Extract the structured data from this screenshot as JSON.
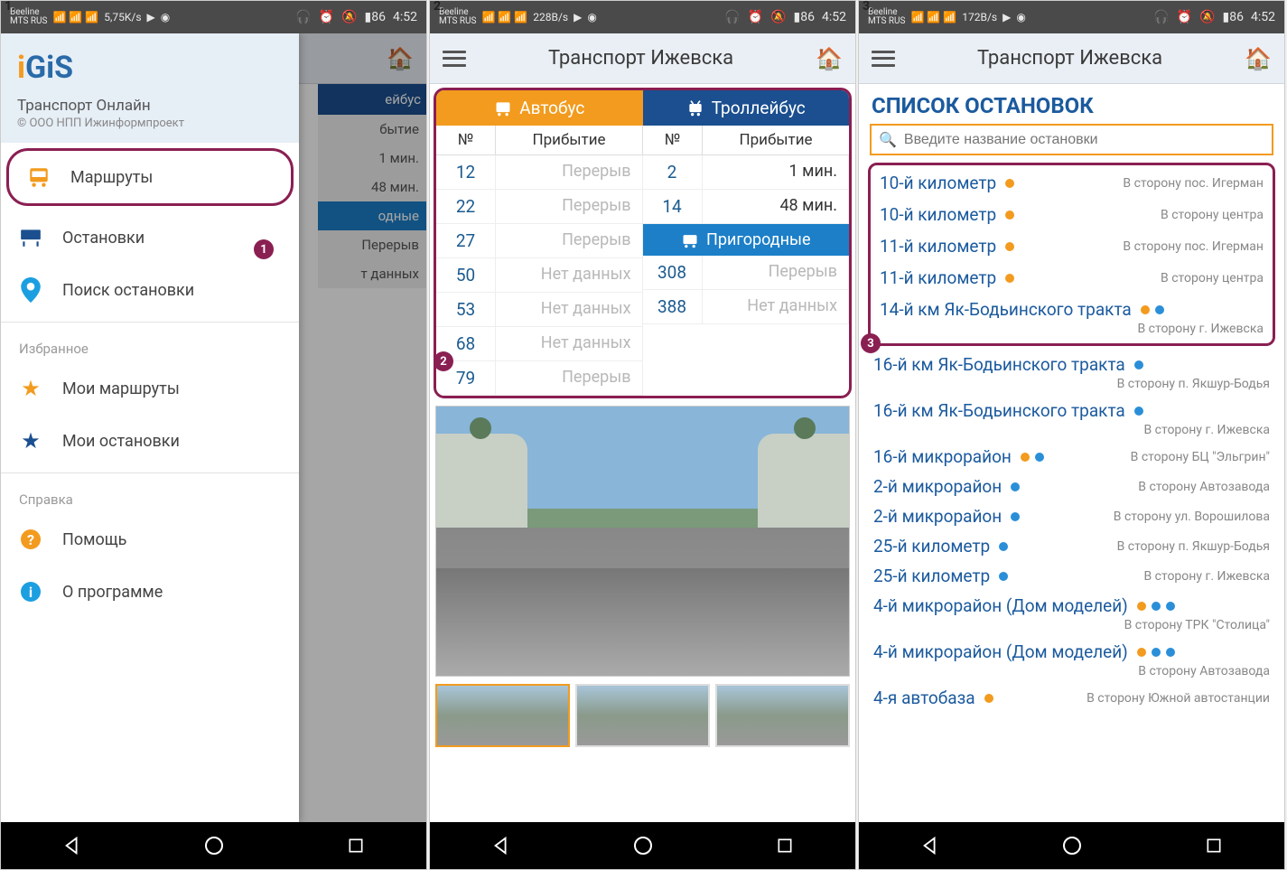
{
  "labels": {
    "p1": "1.",
    "p2": "2.",
    "p3": "3."
  },
  "status": {
    "carrier": "Beeline\nMTS RUS",
    "rate1": "5,75K/s",
    "rate2": "228B/s",
    "rate3": "172B/s",
    "battery": "86",
    "time": "4:52"
  },
  "appbar": {
    "title": "Транспорт Ижевска"
  },
  "drawer": {
    "logo": "IGIS",
    "subtitle": "Транспорт Онлайн",
    "copyright": "© ООО НПП Ижинформпроект",
    "items_main": [
      {
        "icon": "bus",
        "label": "Маршруты"
      },
      {
        "icon": "stop",
        "label": "Остановки"
      },
      {
        "icon": "pin",
        "label": "Поиск остановки"
      }
    ],
    "section_fav": "Избранное",
    "items_fav": [
      {
        "icon": "star-o",
        "label": "Мои маршруты"
      },
      {
        "icon": "star-b",
        "label": "Мои остановки"
      }
    ],
    "section_help": "Справка",
    "items_help": [
      {
        "icon": "help",
        "label": "Помощь"
      },
      {
        "icon": "info",
        "label": "О программе"
      }
    ]
  },
  "bg": {
    "header": "ейбус",
    "rows": [
      "бытие",
      "1 мин.",
      "48 мин.",
      "одные",
      "Перерыв",
      "т данных"
    ]
  },
  "table": {
    "bus_header": "Автобус",
    "trolley_header": "Троллейбус",
    "col_num": "№",
    "col_arr": "Прибытие",
    "suburban": "Пригородные",
    "bus_rows": [
      {
        "num": "12",
        "arr": "Перерыв"
      },
      {
        "num": "22",
        "arr": "Перерыв"
      },
      {
        "num": "27",
        "arr": "Перерыв"
      },
      {
        "num": "50",
        "arr": "Нет данных"
      },
      {
        "num": "53",
        "arr": "Нет данных"
      },
      {
        "num": "68",
        "arr": "Нет данных"
      },
      {
        "num": "79",
        "arr": "Перерыв"
      }
    ],
    "trolley_rows": [
      {
        "num": "2",
        "arr": "1 мин.",
        "dark": true
      },
      {
        "num": "14",
        "arr": "48 мин.",
        "dark": true
      }
    ],
    "suburban_rows": [
      {
        "num": "308",
        "arr": "Перерыв"
      },
      {
        "num": "388",
        "arr": "Нет данных"
      }
    ]
  },
  "stops": {
    "title": "СПИСОК ОСТАНОВОК",
    "placeholder": "Введите название остановки",
    "highlighted": [
      {
        "name": "10-й километр",
        "dots": [
          "o"
        ],
        "dir": "В сторону пос. Игерман"
      },
      {
        "name": "10-й километр",
        "dots": [
          "o"
        ],
        "dir": "В сторону центра"
      },
      {
        "name": "11-й километр",
        "dots": [
          "o"
        ],
        "dir": "В сторону пос. Игерман"
      },
      {
        "name": "11-й километр",
        "dots": [
          "o"
        ],
        "dir": "В сторону центра"
      },
      {
        "name": "14-й км Як-Бодьинского тракта",
        "dots": [
          "o",
          "b"
        ],
        "dir": "В сторону г. Ижевска",
        "two": true
      }
    ],
    "rest": [
      {
        "name": "16-й км Як-Бодьинского тракта",
        "dots": [
          "b"
        ],
        "dir": "В сторону п. Якшур-Бодья",
        "two": true
      },
      {
        "name": "16-й км Як-Бодьинского тракта",
        "dots": [
          "b"
        ],
        "dir": "В сторону г. Ижевска",
        "two": true
      },
      {
        "name": "16-й микрорайон",
        "dots": [
          "o",
          "b"
        ],
        "dir": "В сторону БЦ \"Эльгрин\""
      },
      {
        "name": "2-й микрорайон",
        "dots": [
          "b"
        ],
        "dir": "В сторону Автозавода"
      },
      {
        "name": "2-й микрорайон",
        "dots": [
          "b"
        ],
        "dir": "В сторону ул. Ворошилова"
      },
      {
        "name": "25-й километр",
        "dots": [
          "b"
        ],
        "dir": "В сторону п. Якшур-Бодья"
      },
      {
        "name": "25-й километр",
        "dots": [
          "b"
        ],
        "dir": "В сторону г. Ижевска"
      },
      {
        "name": "4-й микрорайон (Дом моделей)",
        "dots": [
          "o",
          "b",
          "b"
        ],
        "dir": "В сторону ТРК \"Столица\"",
        "two": true
      },
      {
        "name": "4-й микрорайон (Дом моделей)",
        "dots": [
          "o",
          "b",
          "b"
        ],
        "dir": "В сторону Автозавода",
        "two": true
      },
      {
        "name": "4-я автобаза",
        "dots": [
          "o"
        ],
        "dir": "В сторону Южной автостанции"
      }
    ]
  },
  "badges": {
    "b1": "1",
    "b2": "2",
    "b3": "3"
  }
}
